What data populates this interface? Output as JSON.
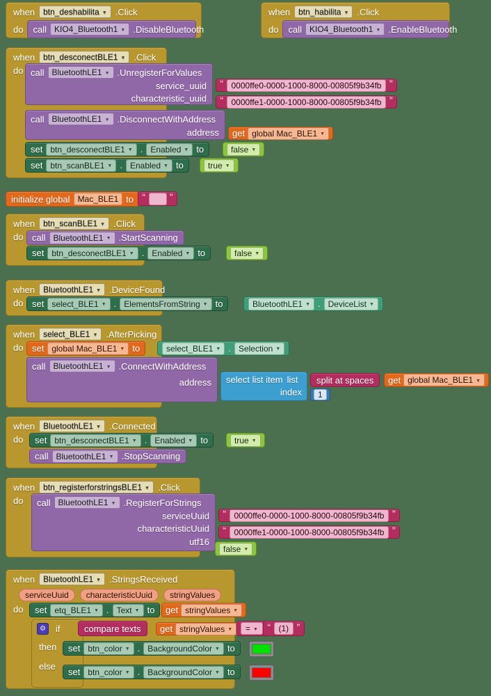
{
  "app": {
    "title": "MIT App Inventor Blocks Editor",
    "canvas_background": "#4a7050"
  },
  "palette": {
    "event_block": "#b8972f",
    "method_call": "#9068a8",
    "setter": "#2f6e4a",
    "component_getter": "#3f9e78",
    "logic": "#8cc63f",
    "text": "#b32d5e",
    "variable": "#e2681c",
    "list": "#3d9ed0",
    "math": "#3b78b5",
    "control": "#b8972f",
    "color_gray": "#8c8c8c",
    "color_green_value": "#00e000",
    "color_red_value": "#ff0000"
  },
  "words": {
    "when": "when",
    "do": "do",
    "call": "call",
    "set": "set",
    "get": "get",
    "to": "to",
    "if": "if",
    "then": "then",
    "else": "else",
    "dot": ".",
    "initialize_global": "initialize global",
    "select_list_item": "select list item",
    "list": "list",
    "index": "index",
    "split_at_spaces": "split at spaces",
    "compare_texts": "compare texts",
    "equals": "=",
    "gear": "⚙"
  },
  "blocks": [
    {
      "id": "when-btn-deshabilita-click",
      "type": "event",
      "component": "btn_deshabilita",
      "event": ".Click",
      "body": [
        {
          "type": "call",
          "component": "KIO4_Bluetooth1",
          "method": ".DisableBluetooth"
        }
      ]
    },
    {
      "id": "when-btn-habilita-click",
      "type": "event",
      "component": "btn_habilita",
      "event": ".Click",
      "body": [
        {
          "type": "call",
          "component": "KIO4_Bluetooth1",
          "method": ".EnableBluetooth"
        }
      ]
    },
    {
      "id": "when-btn-desconectBLE1-click",
      "type": "event",
      "component": "btn_desconectBLE1",
      "event": ".Click",
      "body": [
        {
          "type": "call",
          "component": "BluetoothLE1",
          "method": ".UnregisterForValues",
          "args": [
            {
              "label": "service_uuid",
              "value_type": "text",
              "value": "0000ffe0-0000-1000-8000-00805f9b34fb"
            },
            {
              "label": "characteristic_uuid",
              "value_type": "text",
              "value": "0000ffe1-0000-1000-8000-00805f9b34fb"
            }
          ]
        },
        {
          "type": "call",
          "component": "BluetoothLE1",
          "method": ".DisconnectWithAddress",
          "args": [
            {
              "label": "address",
              "value_type": "variable_get",
              "value": "global Mac_BLE1"
            }
          ]
        },
        {
          "type": "set",
          "component": "btn_desconectBLE1",
          "property": "Enabled",
          "value_type": "logic",
          "value": "false"
        },
        {
          "type": "set",
          "component": "btn_scanBLE1",
          "property": "Enabled",
          "value_type": "logic",
          "value": "true"
        }
      ]
    },
    {
      "id": "initialize-global-mac-ble1",
      "type": "global_init",
      "name": "Mac_BLE1",
      "value_type": "text",
      "value": ""
    },
    {
      "id": "when-btn-scanBLE1-click",
      "type": "event",
      "component": "btn_scanBLE1",
      "event": ".Click",
      "body": [
        {
          "type": "call",
          "component": "BluetoothLE1",
          "method": ".StartScanning"
        },
        {
          "type": "set",
          "component": "btn_desconectBLE1",
          "property": "Enabled",
          "value_type": "logic",
          "value": "false"
        }
      ]
    },
    {
      "id": "when-bluetoothle1-devicefound",
      "type": "event",
      "component": "BluetoothLE1",
      "event": ".DeviceFound",
      "body": [
        {
          "type": "set",
          "component": "select_BLE1",
          "property": "ElementsFromString",
          "value_type": "component_get",
          "value_component": "BluetoothLE1",
          "value_property": "DeviceList"
        }
      ]
    },
    {
      "id": "when-select-ble1-afterpicking",
      "type": "event",
      "component": "select_BLE1",
      "event": ".AfterPicking",
      "body": [
        {
          "type": "set_global",
          "variable": "global Mac_BLE1",
          "value_type": "component_get",
          "value_component": "select_BLE1",
          "value_property": "Selection"
        },
        {
          "type": "call",
          "component": "BluetoothLE1",
          "method": ".ConnectWithAddress",
          "args": [
            {
              "label": "address",
              "value_type": "select_list_item",
              "list_label": "list",
              "index_label": "index",
              "list_value": "split at spaces",
              "list_arg": "global Mac_BLE1",
              "index_value": "1"
            }
          ]
        }
      ]
    },
    {
      "id": "when-bluetoothle1-connected",
      "type": "event",
      "component": "BluetoothLE1",
      "event": ".Connected",
      "body": [
        {
          "type": "set",
          "component": "btn_desconectBLE1",
          "property": "Enabled",
          "value_type": "logic",
          "value": "true"
        },
        {
          "type": "call",
          "component": "BluetoothLE1",
          "method": ".StopScanning"
        }
      ]
    },
    {
      "id": "when-btn-registerforstringsBLE1-click",
      "type": "event",
      "component": "btn_registerforstringsBLE1",
      "event": ".Click",
      "body": [
        {
          "type": "call",
          "component": "BluetoothLE1",
          "method": ".RegisterForStrings",
          "args": [
            {
              "label": "serviceUuid",
              "value_type": "text",
              "value": "0000ffe0-0000-1000-8000-00805f9b34fb"
            },
            {
              "label": "characteristicUuid",
              "value_type": "text",
              "value": "0000ffe1-0000-1000-8000-00805f9b34fb"
            },
            {
              "label": "utf16",
              "value_type": "logic",
              "value": "false"
            }
          ]
        }
      ]
    },
    {
      "id": "when-bluetoothle1-stringsreceived",
      "type": "event",
      "component": "BluetoothLE1",
      "event": ".StringsReceived",
      "params": [
        "serviceUuid",
        "characteristicUuid",
        "stringValues"
      ],
      "body": [
        {
          "type": "set",
          "component": "etq_BLE1",
          "property": "Text",
          "value_type": "variable_get",
          "value": "stringValues"
        },
        {
          "type": "if_else",
          "condition": {
            "type": "compare_texts",
            "left_type": "variable_get",
            "left": "stringValues",
            "operator": "=",
            "right_type": "text",
            "right": "(1)"
          },
          "then": {
            "type": "set",
            "component": "btn_color",
            "property": "BackgroundColor",
            "value_type": "color",
            "value": "#00e000"
          },
          "else": {
            "type": "set",
            "component": "btn_color",
            "property": "BackgroundColor",
            "value_type": "color",
            "value": "#ff0000"
          }
        }
      ]
    }
  ]
}
